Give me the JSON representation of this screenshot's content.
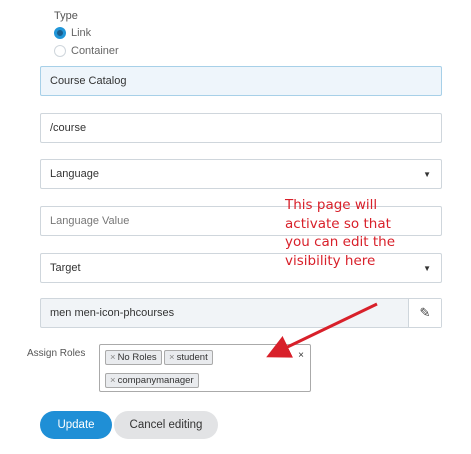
{
  "form": {
    "type_label": "Type",
    "type_options": [
      {
        "label": "Link",
        "selected": true
      },
      {
        "label": "Container",
        "selected": false
      }
    ],
    "title_value": "Course Catalog",
    "url_value": "/course",
    "language_select": "Language",
    "language_value_placeholder": "Language Value",
    "target_select": "Target",
    "icon_class_value": "men men-icon-phcourses",
    "assign_roles_label": "Assign Roles",
    "roles": [
      "No Roles",
      "student",
      "companymanager"
    ],
    "chip_remove_symbol": "×",
    "clear_symbol": "×"
  },
  "buttons": {
    "update_label": "Update",
    "cancel_label": "Cancel editing"
  },
  "annotation": {
    "text": "This page will activate so that you can edit the visibility here",
    "color": "#d8202a"
  },
  "colors": {
    "accent": "#1f8fd6",
    "radio_selected": "#2196d8"
  },
  "icons": {
    "select_caret": "caret-down-icon",
    "edit": "pencil-icon"
  }
}
